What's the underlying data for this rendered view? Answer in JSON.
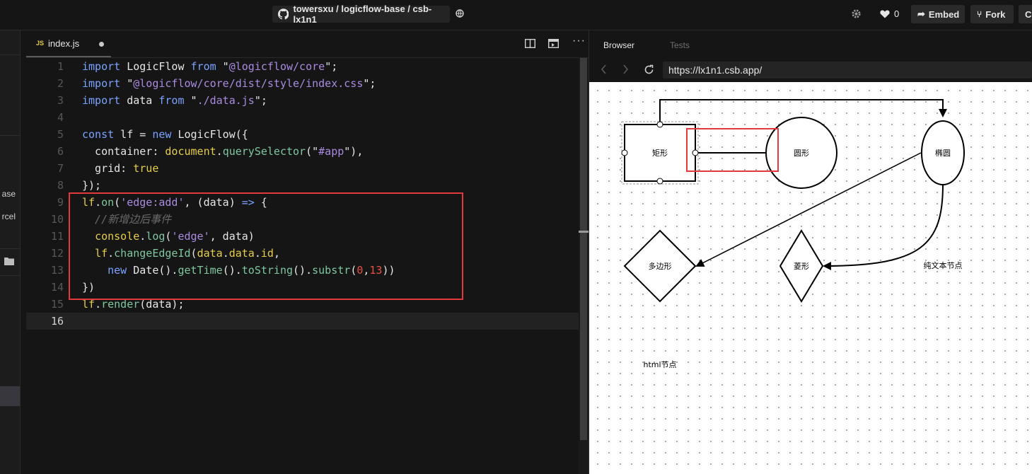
{
  "topbar": {
    "repo_path": "towersxu / logicflow-base / csb-lx1n1",
    "likes": "0",
    "embed_label": "Embed",
    "fork_label": "Fork",
    "cut_label": "C"
  },
  "sidebar": {
    "fragment_1": "ase",
    "fragment_2": "rcel"
  },
  "editor": {
    "tab": {
      "lang": "JS",
      "filename": "index.js"
    },
    "line_numbers": [
      "1",
      "2",
      "3",
      "4",
      "5",
      "6",
      "7",
      "8",
      "9",
      "10",
      "11",
      "12",
      "13",
      "14",
      "15",
      "16"
    ],
    "lines": [
      [
        [
          "kw",
          "import"
        ],
        [
          "cls",
          " LogicFlow "
        ],
        [
          "kw",
          "from"
        ],
        [
          "cls",
          " \""
        ],
        [
          "str",
          "@logicflow/core"
        ],
        [
          "cls",
          "\";"
        ]
      ],
      [
        [
          "kw",
          "import"
        ],
        [
          "cls",
          " \""
        ],
        [
          "str",
          "@logicflow/core/dist/style/index.css"
        ],
        [
          "cls",
          "\";"
        ]
      ],
      [
        [
          "kw",
          "import"
        ],
        [
          "cls",
          " data "
        ],
        [
          "kw",
          "from"
        ],
        [
          "cls",
          " \""
        ],
        [
          "str",
          "./data.js"
        ],
        [
          "cls",
          "\";"
        ]
      ],
      [],
      [
        [
          "kw",
          "const"
        ],
        [
          "cls",
          " lf = "
        ],
        [
          "kw",
          "new"
        ],
        [
          "cls",
          " LogicFlow({"
        ]
      ],
      [
        [
          "cls",
          "  container: "
        ],
        [
          "yel",
          "document"
        ],
        [
          "cls",
          "."
        ],
        [
          "fn",
          "querySelector"
        ],
        [
          "cls",
          "(\""
        ],
        [
          "str",
          "#app"
        ],
        [
          "cls",
          "\"),"
        ]
      ],
      [
        [
          "cls",
          "  grid: "
        ],
        [
          "yel",
          "true"
        ]
      ],
      [
        [
          "cls",
          "});"
        ]
      ],
      [
        [
          "yel",
          "lf"
        ],
        [
          "cls",
          "."
        ],
        [
          "fn",
          "on"
        ],
        [
          "cls",
          "("
        ],
        [
          "str",
          "'edge:add'"
        ],
        [
          "cls",
          ", (data) "
        ],
        [
          "kw",
          "=>"
        ],
        [
          "cls",
          " {"
        ]
      ],
      [
        [
          "cm",
          "  //新增边后事件"
        ]
      ],
      [
        [
          "cls",
          "  "
        ],
        [
          "yel",
          "console"
        ],
        [
          "cls",
          "."
        ],
        [
          "fn",
          "log"
        ],
        [
          "cls",
          "("
        ],
        [
          "str",
          "'edge'"
        ],
        [
          "cls",
          ", data)"
        ]
      ],
      [
        [
          "cls",
          "  "
        ],
        [
          "yel",
          "lf"
        ],
        [
          "cls",
          "."
        ],
        [
          "fn",
          "changeEdgeId"
        ],
        [
          "cls",
          "("
        ],
        [
          "yel",
          "data"
        ],
        [
          "cls",
          "."
        ],
        [
          "yel",
          "data"
        ],
        [
          "cls",
          "."
        ],
        [
          "yel",
          "id"
        ],
        [
          "cls",
          ","
        ]
      ],
      [
        [
          "cls",
          "    "
        ],
        [
          "kw",
          "new"
        ],
        [
          "cls",
          " Date()."
        ],
        [
          "fn",
          "getTime"
        ],
        [
          "cls",
          "()."
        ],
        [
          "fn",
          "toString"
        ],
        [
          "cls",
          "()."
        ],
        [
          "fn",
          "substr"
        ],
        [
          "cls",
          "("
        ],
        [
          "num",
          "0"
        ],
        [
          "cls",
          ","
        ],
        [
          "num",
          "13"
        ],
        [
          "cls",
          "))"
        ]
      ],
      [
        [
          "cls",
          "})"
        ]
      ],
      [
        [
          "yel",
          "lf"
        ],
        [
          "cls",
          "."
        ],
        [
          "fn",
          "render"
        ],
        [
          "cls",
          "(data);"
        ]
      ],
      []
    ]
  },
  "browser": {
    "tab_browser": "Browser",
    "tab_tests": "Tests",
    "url": "https://lx1n1.csb.app/"
  },
  "diagram": {
    "nodes": {
      "rect": "矩形",
      "circle": "圆形",
      "ellipse": "椭圆",
      "polygon": "多边形",
      "diamond": "菱形",
      "text": "纯文本节点",
      "html": "html节点"
    }
  },
  "colors": {
    "highlight_box": "#e23a3a",
    "accent_js": "#e6cd4a"
  }
}
